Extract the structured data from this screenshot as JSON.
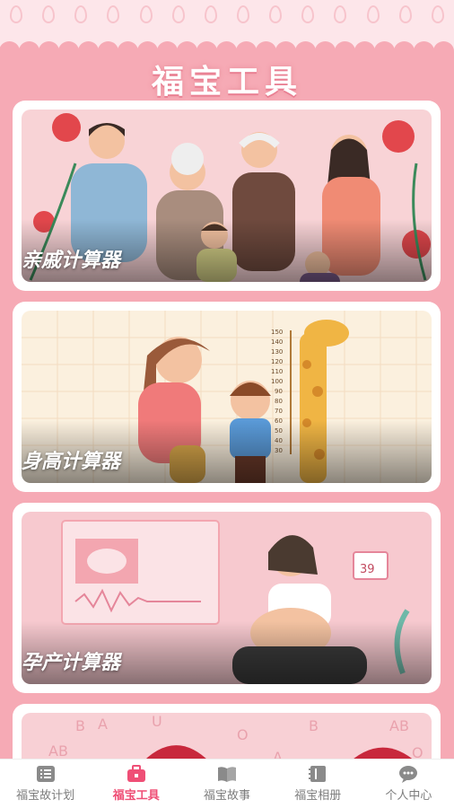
{
  "header": {
    "title": "福宝工具"
  },
  "cards": [
    {
      "label": "亲戚计算器"
    },
    {
      "label": "身高计算器",
      "chart_ticks": [
        "150",
        "140",
        "130",
        "120",
        "110",
        "100",
        "90",
        "80",
        "70",
        "60",
        "50",
        "40",
        "30"
      ]
    },
    {
      "label": "孕产计算器",
      "calendar_day": "39"
    },
    {
      "letters": [
        "B",
        "A",
        "U",
        "AB",
        "O",
        "AB",
        "A",
        "B",
        "O"
      ]
    }
  ],
  "tabbar": {
    "items": [
      {
        "label": "福宝故计划",
        "icon": "list-icon"
      },
      {
        "label": "福宝工具",
        "icon": "toolbox-icon",
        "active": true
      },
      {
        "label": "福宝故事",
        "icon": "book-icon"
      },
      {
        "label": "福宝相册",
        "icon": "album-icon"
      },
      {
        "label": "个人中心",
        "icon": "chat-bubble-icon"
      }
    ]
  },
  "colors": {
    "accent": "#ef4f76",
    "background": "#f6aab5",
    "inactive": "#7d7d7d"
  }
}
